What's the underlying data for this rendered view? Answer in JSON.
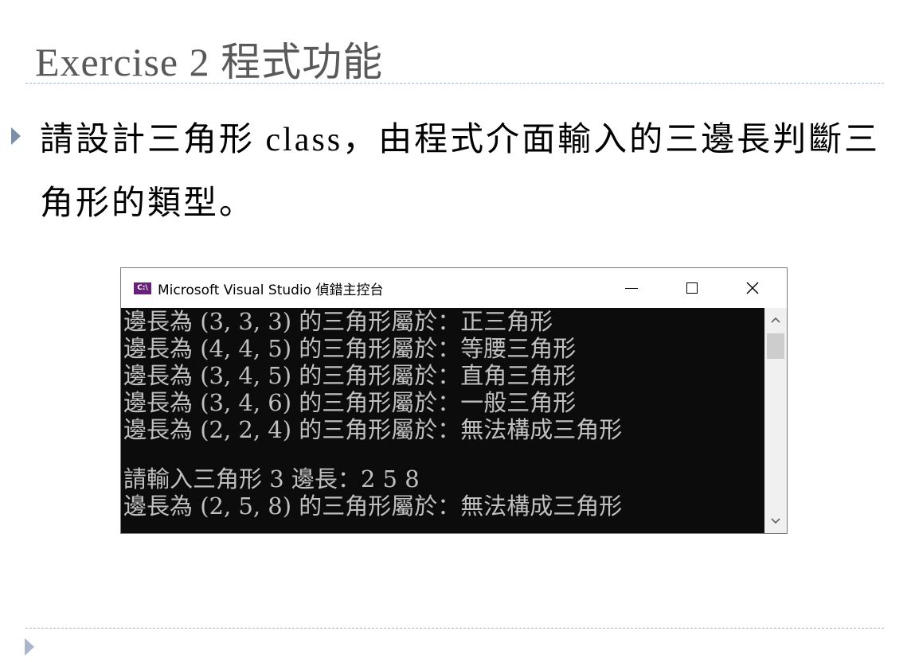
{
  "slide": {
    "title": "Exercise 2 程式功能",
    "body": "請設計三角形 class，由程式介面輸入的三邊長判斷三角形的類型。"
  },
  "console": {
    "window_title": "Microsoft Visual Studio 偵錯主控台",
    "app_icon_text": "C:\\",
    "lines": [
      "邊長為 (3, 3, 3) 的三角形屬於：正三角形",
      "邊長為 (4, 4, 5) 的三角形屬於：等腰三角形",
      "邊長為 (3, 4, 5) 的三角形屬於：直角三角形",
      "邊長為 (3, 4, 6) 的三角形屬於：一般三角形",
      "邊長為 (2, 2, 4) 的三角形屬於：無法構成三角形",
      "",
      "請輸入三角形 3 邊長：2 5 8",
      "邊長為 (2, 5, 8) 的三角形屬於：無法構成三角形"
    ]
  },
  "icons": {
    "bullet": "triangle-bullet-icon",
    "minimize": "minimize-icon",
    "maximize": "maximize-icon",
    "close": "close-icon",
    "scroll_up": "chevron-up-icon",
    "scroll_down": "chevron-down-icon"
  },
  "colors": {
    "title": "#595959",
    "bullet": "#7e8fa8",
    "console_bg": "#0c0c0c",
    "console_text": "#c0c0c0"
  }
}
